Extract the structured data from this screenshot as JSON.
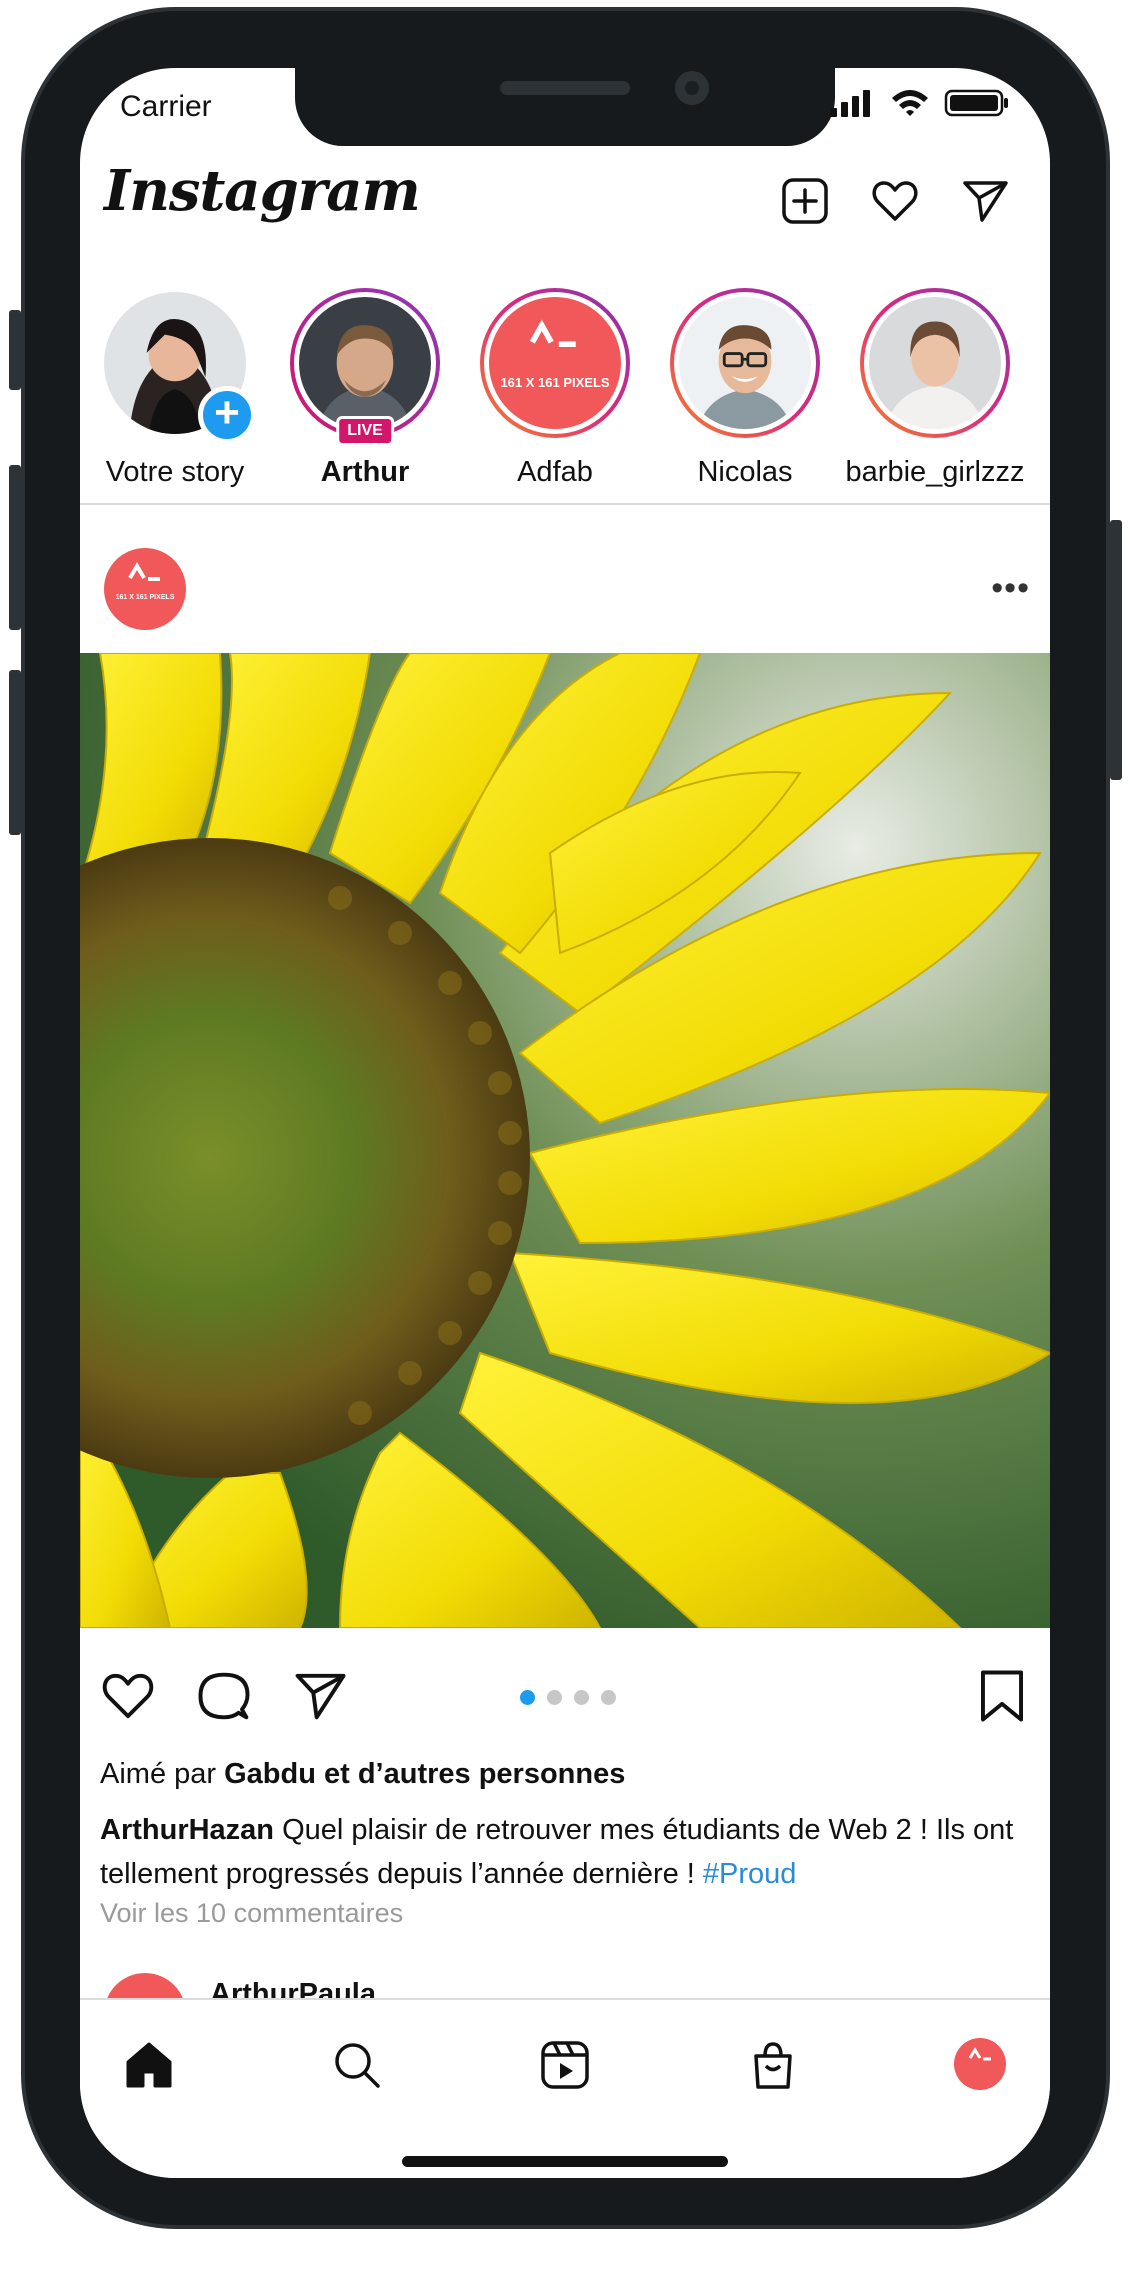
{
  "status_bar": {
    "carrier": "Carrier"
  },
  "header": {
    "logo": "Instagram"
  },
  "stories": [
    {
      "label": "Votre story",
      "bold": false
    },
    {
      "label": "Arthur",
      "bold": true,
      "badge": "LIVE"
    },
    {
      "label": "Adfab",
      "bold": false,
      "avatar_text": "161 X 161 PIXELS"
    },
    {
      "label": "Nicolas",
      "bold": false
    },
    {
      "label": "barbie_girlzzz",
      "bold": false
    }
  ],
  "post": {
    "avatar_text": "161 X 161 PIXELS",
    "liked_prefix": "Aimé par ",
    "liked_by": "Gabdu et d’autres personnes",
    "author": "ArthurHazan",
    "caption_text": " Quel plaisir de retrouver mes étudiants de Web 2 ! Ils ont tellement progressés depuis l’année dernière ! ",
    "hashtag": "#Proud",
    "comments_link": "Voir les 10 commentaires",
    "carousel": {
      "count": 4,
      "active": 1
    }
  },
  "next_post": {
    "author_partial": "ArthurPaula"
  },
  "colors": {
    "accent": "#1d9bf0",
    "live": "#d4166b",
    "brand_red": "#f1585a",
    "hashtag": "#2a8cd8"
  },
  "icons": [
    "new-post-icon",
    "heart-icon",
    "send-icon",
    "comment-icon",
    "bookmark-icon",
    "home-icon",
    "search-icon",
    "reels-icon",
    "shop-icon"
  ]
}
